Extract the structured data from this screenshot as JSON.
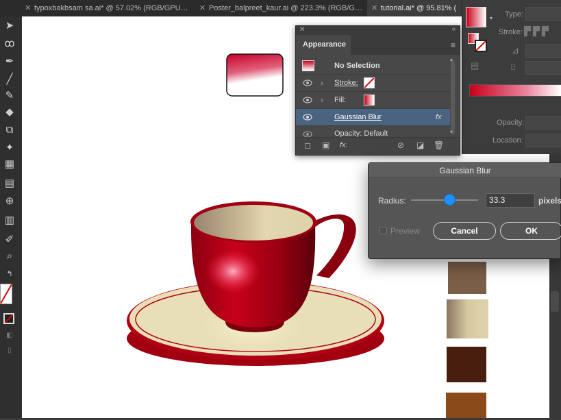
{
  "tabs": [
    {
      "label": "typoxbakbsam sa.ai* @ 57.02% (RGB/GPU…"
    },
    {
      "label": "Poster_balpreet_kaur.ai @ 223.3% (RGB/G…"
    },
    {
      "label": "tutorial.ai* @ 95.81% ("
    }
  ],
  "properties": {
    "type_label": "Type:",
    "stroke_label": "Stroke:",
    "opacity_label": "Opacity:",
    "location_label": "Location:"
  },
  "appearance": {
    "title": "Appearance",
    "rows": [
      {
        "label": "No Selection"
      },
      {
        "label": "Stroke:"
      },
      {
        "label": "Fill:"
      },
      {
        "label": "Gaussian Blur",
        "fx": "fx"
      },
      {
        "label": "Opacity: Default"
      }
    ],
    "footer_fx": "fx."
  },
  "gaussian_blur": {
    "title": "Gaussian Blur",
    "radius_label": "Radius:",
    "radius_value": "33.3",
    "radius_unit": "pixels",
    "radius_slider_fraction": 0.58,
    "preview_label": "Preview",
    "cancel_label": "Cancel",
    "ok_label": "OK"
  },
  "colors": {
    "cup_red": "#b0000e",
    "cream": "#e8dfb8",
    "selection_blue": "#4a6380",
    "slider_blue": "#1e90ff",
    "swatches": [
      "#7a5e48",
      "#c8b896",
      "#4a1e0e",
      "#8a4a1a"
    ]
  },
  "icons": [
    "close-icon",
    "collapse-icon",
    "panel-menu-icon",
    "eye-icon",
    "chevron-right-icon",
    "fx-icon",
    "delete-icon"
  ]
}
